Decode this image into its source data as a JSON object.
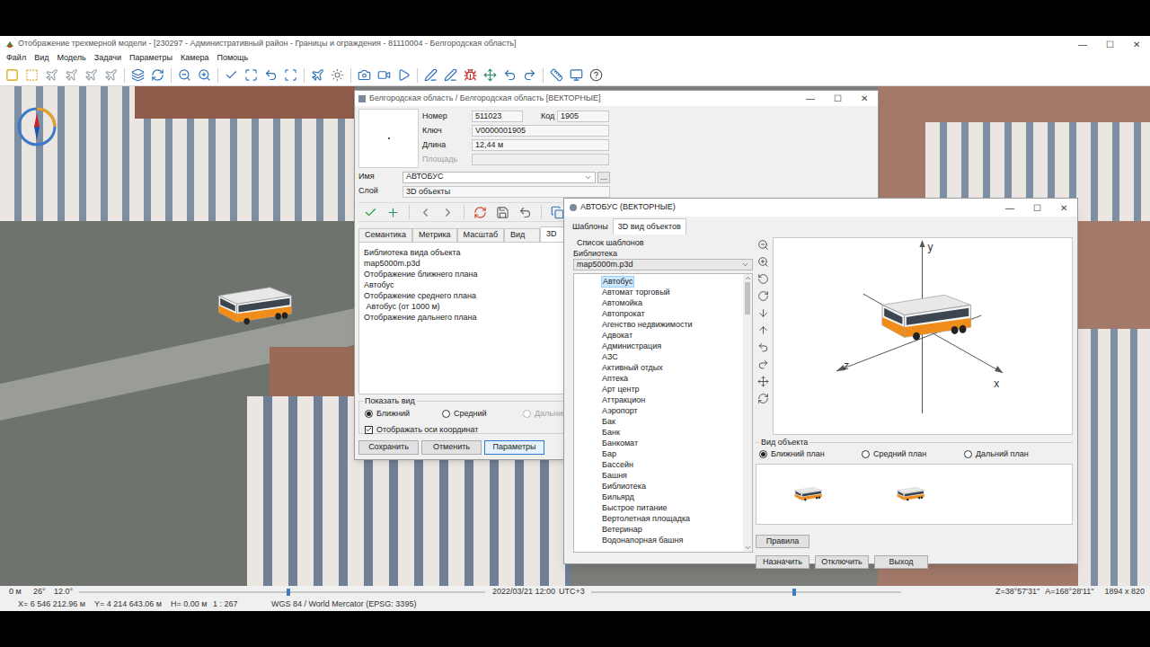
{
  "app": {
    "title": "Отображение трехмерной модели - [230297 - Административный район - Границы и ограждения - 81110004 - Белгородская область]",
    "controls": [
      "—",
      "☐",
      "✕"
    ]
  },
  "menu": [
    "Файл",
    "Вид",
    "Модель",
    "Задачи",
    "Параметры",
    "Камера",
    "Помощь"
  ],
  "status_bar": {
    "distance": "0 м",
    "heading": "26°",
    "tilt": "12.0°",
    "view_slider_level": 0.51,
    "date": "2022/03/21 12:00",
    "timezone": "UTC+3",
    "time_slider_level": 0.65,
    "camera_z": "Z=38°57'31\"",
    "camera_a": "A=168°28'11\"",
    "size": "1894 x 820",
    "x": "X= 6 546 212.96 м",
    "y": "Y= 4 214 643.06 м",
    "h": "H= 0.00 м",
    "scale": "1 : 267",
    "projection": "WGS 84 / World Mercator (EPSG: 3395)"
  },
  "object_window": {
    "title": "Белгородская область / Белгородская область [ВЕКТОРНЫЕ]",
    "controls": [
      "—",
      "☐",
      "✕"
    ],
    "fields": [
      {
        "label": "Номер",
        "value": "511023",
        "disabled": false
      },
      {
        "label": "Ключ",
        "value": "V0000001905",
        "disabled": false
      },
      {
        "label": "Длина",
        "value": "12,44 м",
        "disabled": false
      },
      {
        "label": "Площадь",
        "value": "",
        "disabled": true
      }
    ],
    "code": {
      "label": "Код",
      "value": "1905"
    },
    "name": {
      "label": "Имя",
      "value": "АВТОБУС",
      "button": "..."
    },
    "layer": {
      "label": "Слой",
      "value": "3D объекты"
    },
    "tabs": [
      {
        "label": "Семантика",
        "selected": false
      },
      {
        "label": "Метрика",
        "selected": false
      },
      {
        "label": "Масштаб",
        "selected": false
      },
      {
        "label": "Вид",
        "selected": false
      },
      {
        "label": "3D",
        "selected": true
      }
    ],
    "details": [
      "Библиотека вида объекта",
      "map5000m.p3d",
      "Отображение ближнего плана",
      "Автобус",
      "Отображение среднего плана",
      " Автобус (от 1000 м)",
      "Отображение дальнего плана"
    ],
    "view_group": {
      "title": "Показать вид",
      "options": [
        {
          "label": "Ближний",
          "selected": true,
          "disabled": false
        },
        {
          "label": "Средний",
          "selected": false,
          "disabled": false
        },
        {
          "label": "Дальний",
          "selected": false,
          "disabled": true
        }
      ]
    },
    "axes_checkbox": {
      "label": "Отображать оси координат",
      "checked": true
    },
    "buttons": [
      {
        "label": "Сохранить",
        "focused": false
      },
      {
        "label": "Отменить",
        "focused": false
      },
      {
        "label": "Параметры",
        "focused": true
      }
    ]
  },
  "template_window": {
    "title": "АВТОБУС (ВЕКТОРНЫЕ)",
    "controls": [
      "—",
      "☐",
      "✕"
    ],
    "tabs": [
      {
        "label": "Шаблоны",
        "selected": false
      },
      {
        "label": "3D вид объектов",
        "selected": true
      }
    ],
    "list_title": "Список шаблонов",
    "library": {
      "label": "Библиотека",
      "value": "map5000m.p3d"
    },
    "templates": [
      {
        "label": "Автобус",
        "selected": true
      },
      {
        "label": "Автомат торговый",
        "selected": false
      },
      {
        "label": "Автомойка",
        "selected": false
      },
      {
        "label": "Автопрокат",
        "selected": false
      },
      {
        "label": "Агенство недвижимости",
        "selected": false
      },
      {
        "label": "Адвокат",
        "selected": false
      },
      {
        "label": "Администрация",
        "selected": false
      },
      {
        "label": "АЗС",
        "selected": false
      },
      {
        "label": "Активный отдых",
        "selected": false
      },
      {
        "label": "Аптека",
        "selected": false
      },
      {
        "label": "Арт центр",
        "selected": false
      },
      {
        "label": "Аттракцион",
        "selected": false
      },
      {
        "label": "Аэропорт",
        "selected": false
      },
      {
        "label": "Бак",
        "selected": false
      },
      {
        "label": "Банк",
        "selected": false
      },
      {
        "label": "Банкомат",
        "selected": false
      },
      {
        "label": "Бар",
        "selected": false
      },
      {
        "label": "Бассейн",
        "selected": false
      },
      {
        "label": "Башня",
        "selected": false
      },
      {
        "label": "Библиотека",
        "selected": false
      },
      {
        "label": "Бильярд",
        "selected": false
      },
      {
        "label": "Быстрое питание",
        "selected": false
      },
      {
        "label": "Вертолетная площадка",
        "selected": false
      },
      {
        "label": "Ветеринар",
        "selected": false
      },
      {
        "label": "Водонапорная башня",
        "selected": false
      }
    ],
    "list_scroll_level": 0,
    "axes": {
      "y": "y",
      "z": "z",
      "x": "x"
    },
    "view_group": {
      "title": "Вид объекта",
      "options": [
        {
          "label": "Ближний план",
          "selected": true,
          "disabled": false
        },
        {
          "label": "Средний план",
          "selected": false,
          "disabled": false
        },
        {
          "label": "Дальний план",
          "selected": false,
          "disabled": false
        }
      ]
    },
    "rules_button": "Правила",
    "buttons": [
      "Назначить",
      "Отключить",
      "Выход"
    ]
  }
}
